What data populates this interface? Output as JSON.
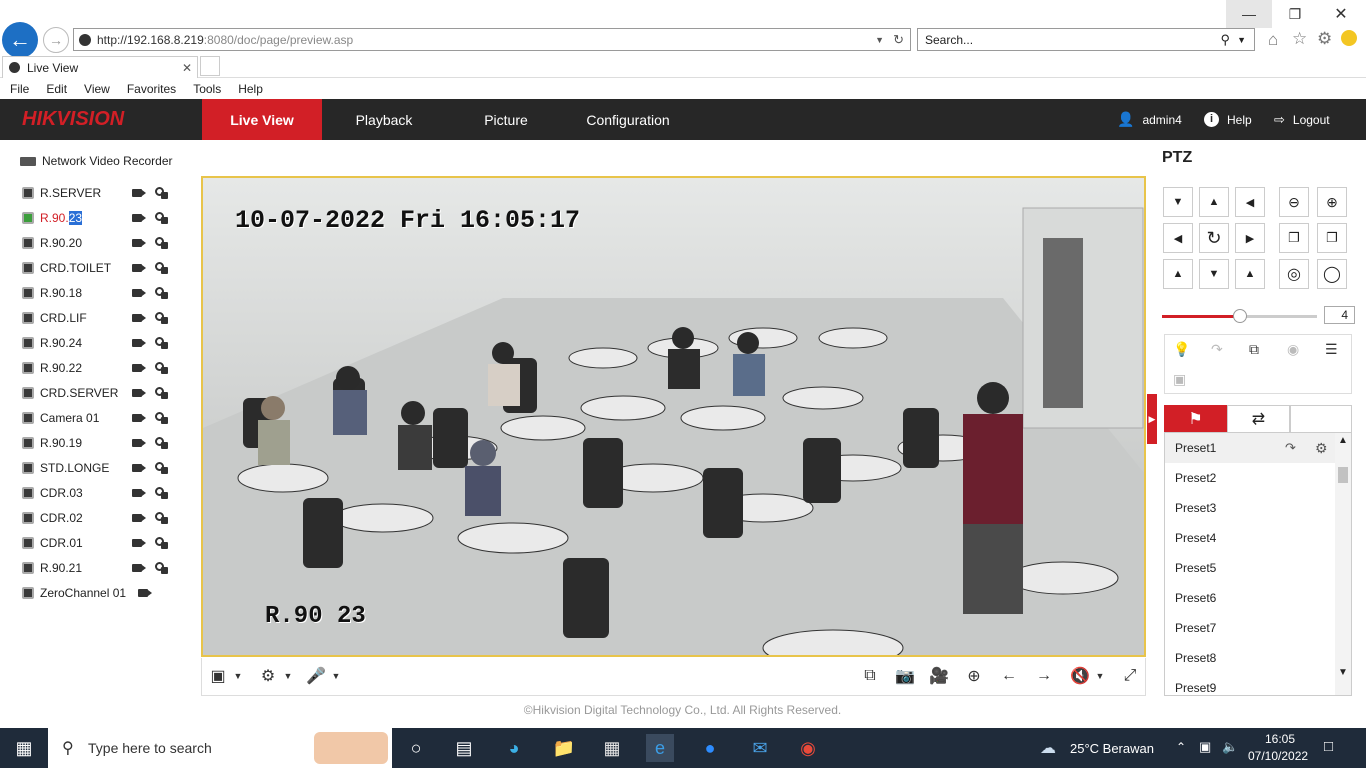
{
  "browser": {
    "url_host": "http://192.168.8.219",
    "url_rest": ":8080/doc/page/preview.asp",
    "search_placeholder": "Search...",
    "tab_title": "Live View",
    "menu": [
      "File",
      "Edit",
      "View",
      "Favorites",
      "Tools",
      "Help"
    ]
  },
  "app": {
    "logo": "HIKVISION",
    "nav": [
      "Live View",
      "Playback",
      "Picture",
      "Configuration"
    ],
    "user": "admin4",
    "help": "Help",
    "logout": "Logout",
    "copyright": "©Hikvision Digital Technology Co., Ltd. All Rights Reserved."
  },
  "tree": {
    "root": "Network Video Recorder",
    "cameras": [
      {
        "name": "R.SERVER"
      },
      {
        "name_a": "R.90.",
        "name_b": "23"
      },
      {
        "name": "R.90.20"
      },
      {
        "name": "CRD.TOILET"
      },
      {
        "name": "R.90.18"
      },
      {
        "name": "CRD.LIF"
      },
      {
        "name": "R.90.24"
      },
      {
        "name": "R.90.22"
      },
      {
        "name": "CRD.SERVER"
      },
      {
        "name": "Camera 01"
      },
      {
        "name": "R.90.19"
      },
      {
        "name": "STD.LONGE"
      },
      {
        "name": "CDR.03"
      },
      {
        "name": "CDR.02"
      },
      {
        "name": "CDR.01"
      },
      {
        "name": "R.90.21"
      },
      {
        "name": "ZeroChannel 01"
      }
    ]
  },
  "video": {
    "osd_time": "10-07-2022 Fri 16:05:17",
    "osd_name": "R.90 23"
  },
  "ptz": {
    "title": "PTZ",
    "speed": 4,
    "speed_fraction": 0.5,
    "presets": [
      "Preset1",
      "Preset2",
      "Preset3",
      "Preset4",
      "Preset5",
      "Preset6",
      "Preset7",
      "Preset8",
      "Preset9"
    ]
  },
  "taskbar": {
    "search": "Type here to search",
    "weather": "25°C  Berawan",
    "time": "16:05",
    "date": "07/10/2022"
  },
  "colors": {
    "accent": "#d21f26",
    "header": "#272727",
    "video_border": "#e8c44a"
  }
}
